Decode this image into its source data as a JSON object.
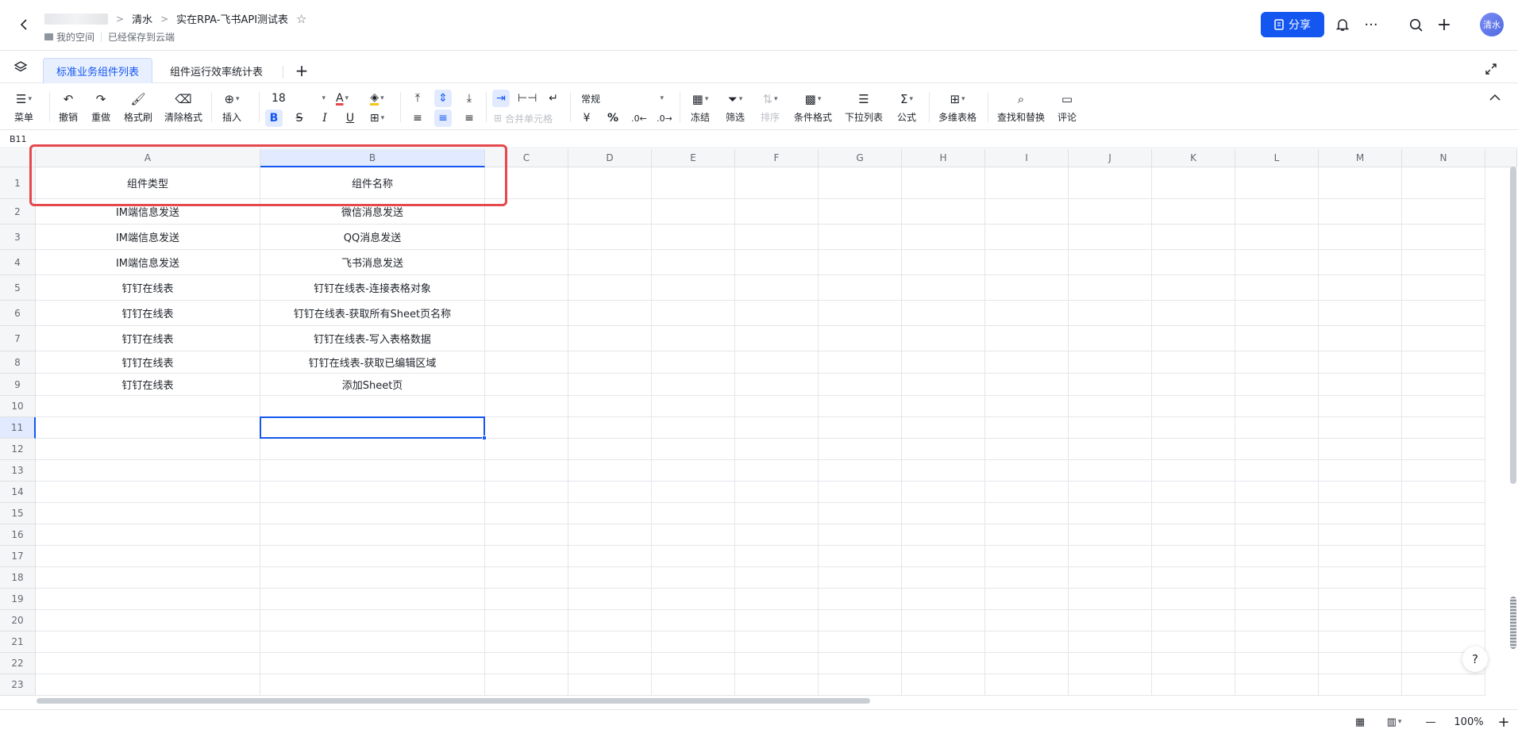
{
  "header": {
    "breadcrumb_parent": "清水",
    "doc_title": "实在RPA-飞书API测试表",
    "space_label": "我的空间",
    "save_status": "已经保存到云端",
    "share_label": "分享",
    "avatar_text": "清水"
  },
  "sheet_tabs": [
    {
      "label": "标准业务组件列表",
      "active": true
    },
    {
      "label": "组件运行效率统计表",
      "active": false
    }
  ],
  "toolbar": {
    "menu": "菜单",
    "undo": "撤销",
    "redo": "重做",
    "format_painter": "格式刷",
    "clear_format": "清除格式",
    "insert": "插入",
    "font_size": "18",
    "merge_cells": "合并单元格",
    "number_format": "常规",
    "freeze": "冻结",
    "filter": "筛选",
    "sort": "排序",
    "conditional_format": "条件格式",
    "dropdown_list": "下拉列表",
    "formula": "公式",
    "multi_table": "多维表格",
    "find_replace": "查找和替换",
    "comment": "评论",
    "currency_symbol": "¥",
    "percent_symbol": "%"
  },
  "name_box": "B11",
  "columns": [
    "A",
    "B",
    "C",
    "D",
    "E",
    "F",
    "G",
    "H",
    "I",
    "J",
    "K",
    "L",
    "M",
    "N"
  ],
  "rows": [
    {
      "num": "1",
      "a": "组件类型",
      "b": "组件名称"
    },
    {
      "num": "2",
      "a": "IM端信息发送",
      "b": "微信消息发送"
    },
    {
      "num": "3",
      "a": "IM端信息发送",
      "b": "QQ消息发送"
    },
    {
      "num": "4",
      "a": "IM端信息发送",
      "b": "飞书消息发送"
    },
    {
      "num": "5",
      "a": "钉钉在线表",
      "b": "钉钉在线表-连接表格对象"
    },
    {
      "num": "6",
      "a": "钉钉在线表",
      "b": "钉钉在线表-获取所有Sheet页名称"
    },
    {
      "num": "7",
      "a": "钉钉在线表",
      "b": "钉钉在线表-写入表格数据"
    },
    {
      "num": "8",
      "a": "钉钉在线表",
      "b": "钉钉在线表-获取已编辑区域"
    },
    {
      "num": "9",
      "a": "钉钉在线表",
      "b": "添加Sheet页"
    },
    {
      "num": "10",
      "a": "",
      "b": ""
    },
    {
      "num": "11",
      "a": "",
      "b": ""
    },
    {
      "num": "12",
      "a": "",
      "b": ""
    },
    {
      "num": "13",
      "a": "",
      "b": ""
    },
    {
      "num": "14",
      "a": "",
      "b": ""
    },
    {
      "num": "15",
      "a": "",
      "b": ""
    },
    {
      "num": "16",
      "a": "",
      "b": ""
    },
    {
      "num": "17",
      "a": "",
      "b": ""
    },
    {
      "num": "18",
      "a": "",
      "b": ""
    },
    {
      "num": "19",
      "a": "",
      "b": ""
    },
    {
      "num": "20",
      "a": "",
      "b": ""
    },
    {
      "num": "21",
      "a": "",
      "b": ""
    },
    {
      "num": "22",
      "a": "",
      "b": ""
    },
    {
      "num": "23",
      "a": "",
      "b": ""
    }
  ],
  "status": {
    "zoom": "100%"
  },
  "colors": {
    "accent": "#1456f0",
    "highlight": "#e5484d"
  }
}
